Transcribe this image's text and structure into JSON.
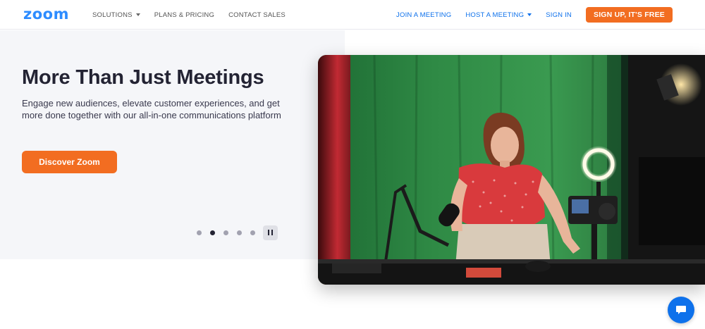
{
  "header": {
    "logo": "zoom",
    "nav_left": [
      {
        "label": "SOLUTIONS",
        "dropdown": true
      },
      {
        "label": "PLANS & PRICING",
        "dropdown": false
      },
      {
        "label": "CONTACT SALES",
        "dropdown": false
      }
    ],
    "nav_right": [
      {
        "label": "JOIN A MEETING",
        "dropdown": false
      },
      {
        "label": "HOST A MEETING",
        "dropdown": true
      },
      {
        "label": "SIGN IN",
        "dropdown": false
      }
    ],
    "signup_label": "SIGN UP, IT'S FREE"
  },
  "hero": {
    "title": "More Than Just Meetings",
    "subtitle": "Engage new audiences, elevate customer experiences, and get more done together with our all-in-one communications platform",
    "cta_label": "Discover Zoom",
    "carousel": {
      "slides": 5,
      "active_index": 1
    }
  },
  "colors": {
    "brand_blue": "#2d8cff",
    "link_blue": "#0e71eb",
    "cta_orange": "#f26d21",
    "text_dark": "#232333"
  },
  "icons": {
    "pause": "pause-icon",
    "chat": "chat-bubble-icon"
  }
}
